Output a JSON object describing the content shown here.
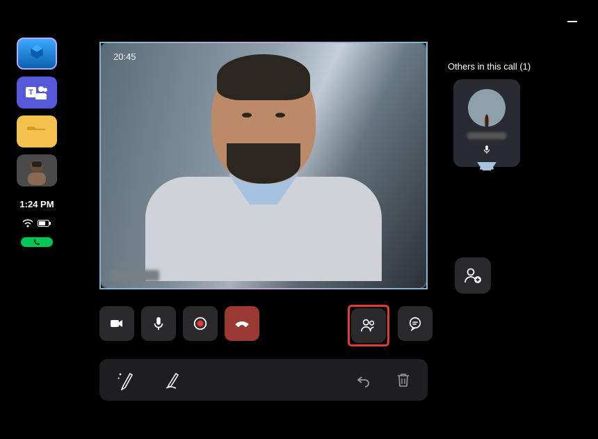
{
  "call": {
    "duration": "20:45",
    "main_participant_name": "(blurred)"
  },
  "clock": "1:24 PM",
  "others_panel": {
    "label": "Others in this call (1)",
    "participant_name": "(blurred)"
  },
  "sidebar": {
    "items": [
      {
        "name": "dynamics"
      },
      {
        "name": "teams"
      },
      {
        "name": "files"
      },
      {
        "name": "profile-avatar"
      }
    ]
  }
}
